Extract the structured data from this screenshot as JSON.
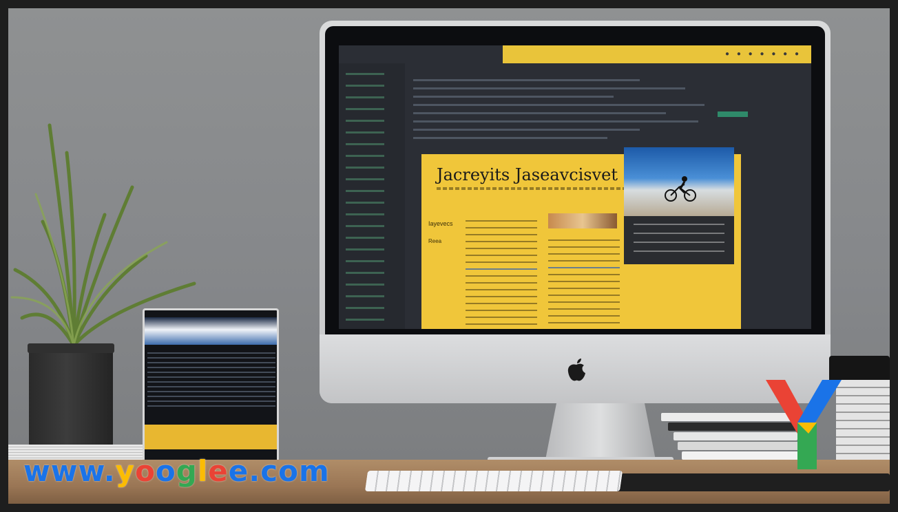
{
  "screen": {
    "document_title": "Jacreyits Jaseavcisvet",
    "label_primary": "Iayevecs",
    "label_secondary": "Reea"
  },
  "watermark": {
    "text_parts": [
      {
        "text": "www.",
        "color": "#1a73e8"
      },
      {
        "text": "y",
        "color": "#fbbc04"
      },
      {
        "text": "o",
        "color": "#ea4335"
      },
      {
        "text": "o",
        "color": "#1a73e8"
      },
      {
        "text": "g",
        "color": "#34a853"
      },
      {
        "text": "l",
        "color": "#fbbc04"
      },
      {
        "text": "e",
        "color": "#ea4335"
      },
      {
        "text": "e",
        "color": "#1a73e8"
      },
      {
        "text": ".com",
        "color": "#1a73e8"
      }
    ]
  },
  "colors": {
    "accent_yellow": "#f0c63a",
    "screen_dark": "#2b2e35",
    "desk_wood": "#9a7655"
  },
  "icons": [
    "apple-logo-icon",
    "yooglee-y-logo"
  ]
}
